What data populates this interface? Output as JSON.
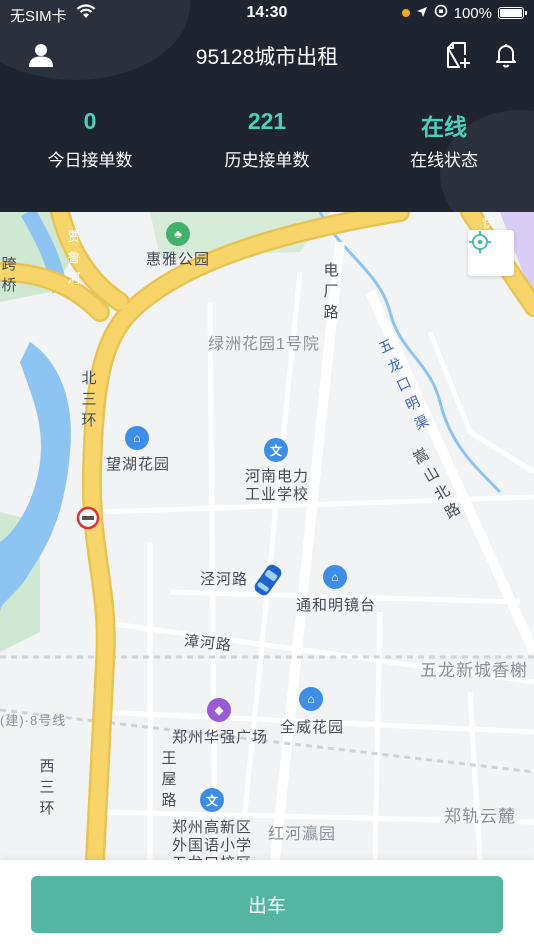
{
  "status_bar": {
    "carrier": "无SIM卡",
    "time": "14:30",
    "battery": "100%",
    "battery_level": 1.0
  },
  "header": {
    "title": "95128城市出租",
    "icons": [
      "user-icon",
      "add-document-icon",
      "bell-icon"
    ]
  },
  "stats": [
    {
      "value": "0",
      "label": "今日接单数"
    },
    {
      "value": "221",
      "label": "历史接单数"
    },
    {
      "value": "在线",
      "label": "在线状态"
    }
  ],
  "map": {
    "labels": {
      "park": "惠雅公园",
      "lvzhou": "绿洲花园1号院",
      "wanghu": "望湖花园",
      "henan_school": "河南电力",
      "henan_school2": "工业学校",
      "jinghe": "泾河路",
      "tonghe": "通和明镜台",
      "zhanghe": "漳河路",
      "wulong": "五龙新城香榭",
      "line8": "(建)·8号线",
      "huaqiang": "郑州华强广场",
      "quanwei": "全威花园",
      "gaoxin1": "郑州高新区",
      "gaoxin2": "外国语小学",
      "gaoxin3": "五龙口校区",
      "hongheying": "红河瀛园",
      "zhenggui": "郑轨云麓",
      "beisanhuan": "北三环",
      "xisanhuan": "西三环",
      "dianchang": "电厂路",
      "songshan": "嵩山北路",
      "wangwu": "王屋路",
      "jialu": "贾鲁河",
      "wulongkou": "五龙口明渠",
      "kuaisu": "快",
      "kuaqiao": "跨桥"
    }
  },
  "action": {
    "depart_label": "出车"
  },
  "colors": {
    "header_bg": "#1e2530",
    "accent": "#4dd0bb",
    "button": "#53b5a2",
    "road_major": "#f7d56b",
    "water": "#8ec4f2"
  }
}
